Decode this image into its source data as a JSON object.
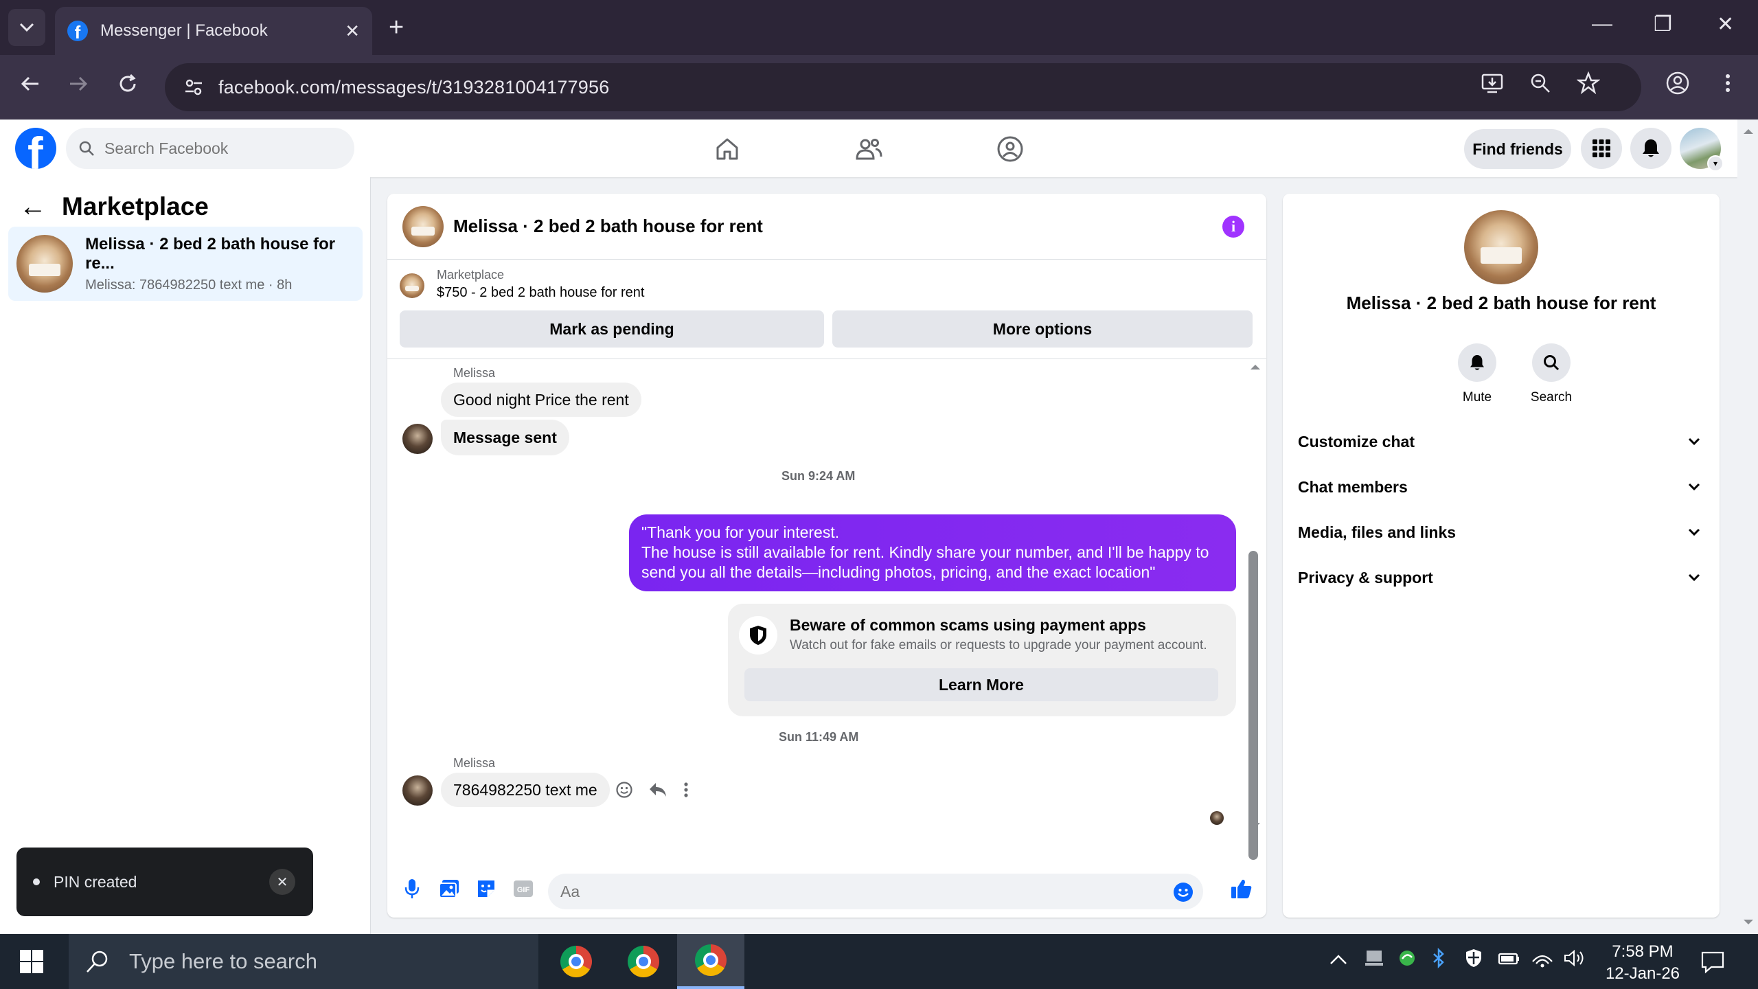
{
  "browser": {
    "tab_title": "Messenger | Facebook",
    "new_tab": "+",
    "url": "facebook.com/messages/t/3193281004177956",
    "minimize": "—",
    "restore": "❐",
    "close": "✕"
  },
  "fb_header": {
    "logo": "f",
    "search_placeholder": "Search Facebook",
    "find_friends": "Find friends"
  },
  "sidebar": {
    "back": "←",
    "title": "Marketplace",
    "conversations": [
      {
        "name": "Melissa · 2 bed 2 bath house for re...",
        "preview": "Melissa: 7864982250 text me · 8h"
      }
    ]
  },
  "chat": {
    "title": "Melissa · 2 bed 2 bath house for rent",
    "info": "i",
    "listing_label": "Marketplace",
    "listing_price": "$750 - 2 bed 2 bath house for rent",
    "mark_pending": "Mark as pending",
    "more_options": "More options",
    "messages": {
      "sender1": "Melissa",
      "msg1": "Good night  Price the rent",
      "msg2": "Message sent",
      "time1": "Sun 9:24 AM",
      "outgoing_line1": "\"Thank you for your interest.",
      "outgoing_line2": "The house is still available for rent. Kindly share your number, and I'll be happy to",
      "outgoing_line3": "send you all the details—including photos, pricing, and the exact location\"",
      "scam_title": "Beware of common scams using payment apps",
      "scam_desc": "Watch out for fake emails or requests to upgrade your payment account.",
      "learn_more": "Learn More",
      "time2": "Sun 11:49 AM",
      "sender2": "Melissa",
      "msg3": "7864982250 text me"
    },
    "composer_placeholder": "Aa"
  },
  "right_panel": {
    "name": "Melissa · 2 bed 2 bath house for rent",
    "mute": "Mute",
    "search": "Search",
    "sections": [
      "Customize chat",
      "Chat members",
      "Media, files and links",
      "Privacy & support"
    ]
  },
  "toast": {
    "text": "PIN created",
    "close": "✕"
  },
  "taskbar": {
    "search_placeholder": "Type here to search",
    "time": "7:58 PM",
    "date": "12-Jan-26"
  },
  "colors": {
    "fb_blue": "#0866ff",
    "outgoing_bubble": "#7a25f0",
    "info_purple": "#a033ff",
    "sidebar_selected": "#ebf5ff"
  }
}
